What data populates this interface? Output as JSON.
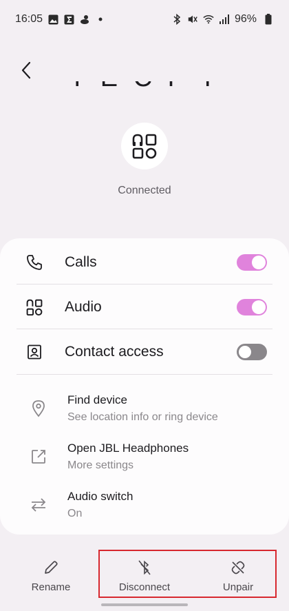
{
  "status_bar": {
    "time": "16:05",
    "battery": "96%",
    "left_icons": [
      "gallery-icon",
      "sigma-icon",
      "duck-icon",
      "dot-icon"
    ],
    "right_icons": [
      "bluetooth-icon",
      "mute-icon",
      "wifi-icon",
      "signal-icon",
      "battery-icon"
    ]
  },
  "header": {
    "title": "T E C P T"
  },
  "device": {
    "status": "Connected",
    "icon": "audio-device-icon"
  },
  "toggles": [
    {
      "label": "Calls",
      "on": true,
      "icon": "phone-icon"
    },
    {
      "label": "Audio",
      "on": true,
      "icon": "audio-icon"
    },
    {
      "label": "Contact access",
      "on": false,
      "icon": "contact-icon"
    }
  ],
  "options": [
    {
      "title": "Find device",
      "subtitle": "See location info or ring device",
      "icon": "location-pin-icon"
    },
    {
      "title": "Open JBL Headphones",
      "subtitle": "More settings",
      "icon": "open-external-icon"
    },
    {
      "title": "Audio switch",
      "subtitle": "On",
      "icon": "swap-arrows-icon"
    }
  ],
  "bottom_actions": {
    "rename": "Rename",
    "disconnect": "Disconnect",
    "unpair": "Unpair"
  },
  "colors": {
    "accent": "#e083dc",
    "highlight": "#d7272e",
    "background": "#f3eff3"
  }
}
